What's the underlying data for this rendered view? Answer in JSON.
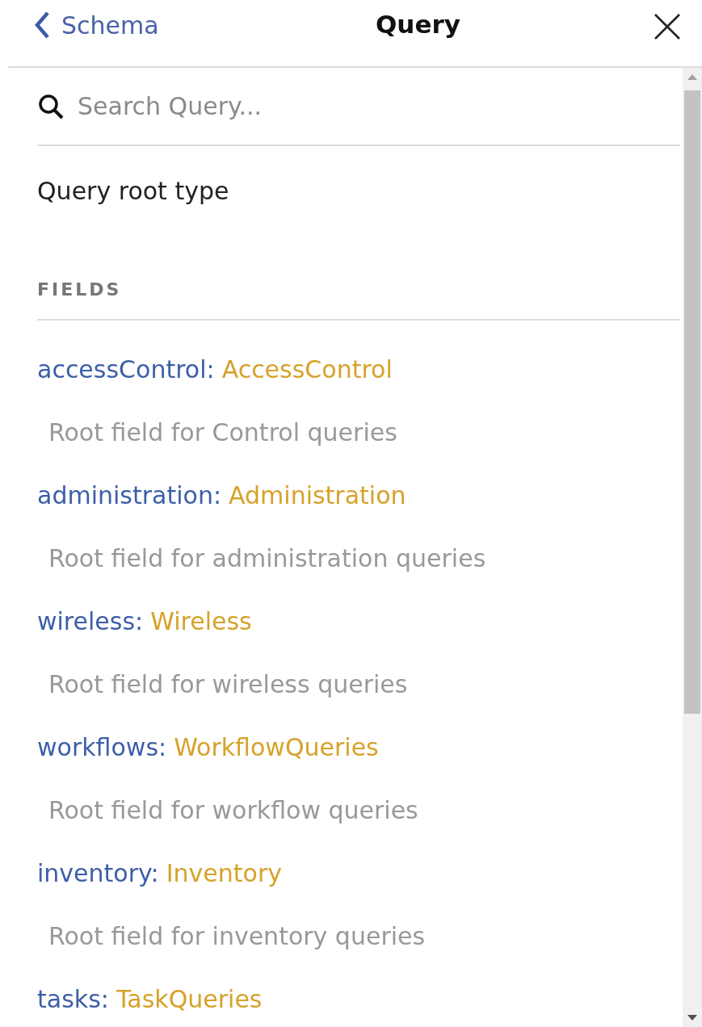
{
  "header": {
    "back_label": "Schema",
    "title": "Query"
  },
  "search": {
    "placeholder": "Search Query..."
  },
  "description": "Query root type",
  "section_title": "FIELDS",
  "fields": [
    {
      "name": "accessControl:",
      "type": "AccessControl",
      "description": "Root field for Control queries"
    },
    {
      "name": "administration:",
      "type": "Administration",
      "description": "Root field for administration queries"
    },
    {
      "name": "wireless:",
      "type": "Wireless",
      "description": "Root field for wireless queries"
    },
    {
      "name": "workflows:",
      "type": "WorkflowQueries",
      "description": "Root field for workflow queries"
    },
    {
      "name": "inventory:",
      "type": "Inventory",
      "description": "Root field for inventory queries"
    },
    {
      "name": "tasks:",
      "type": "TaskQueries"
    }
  ]
}
